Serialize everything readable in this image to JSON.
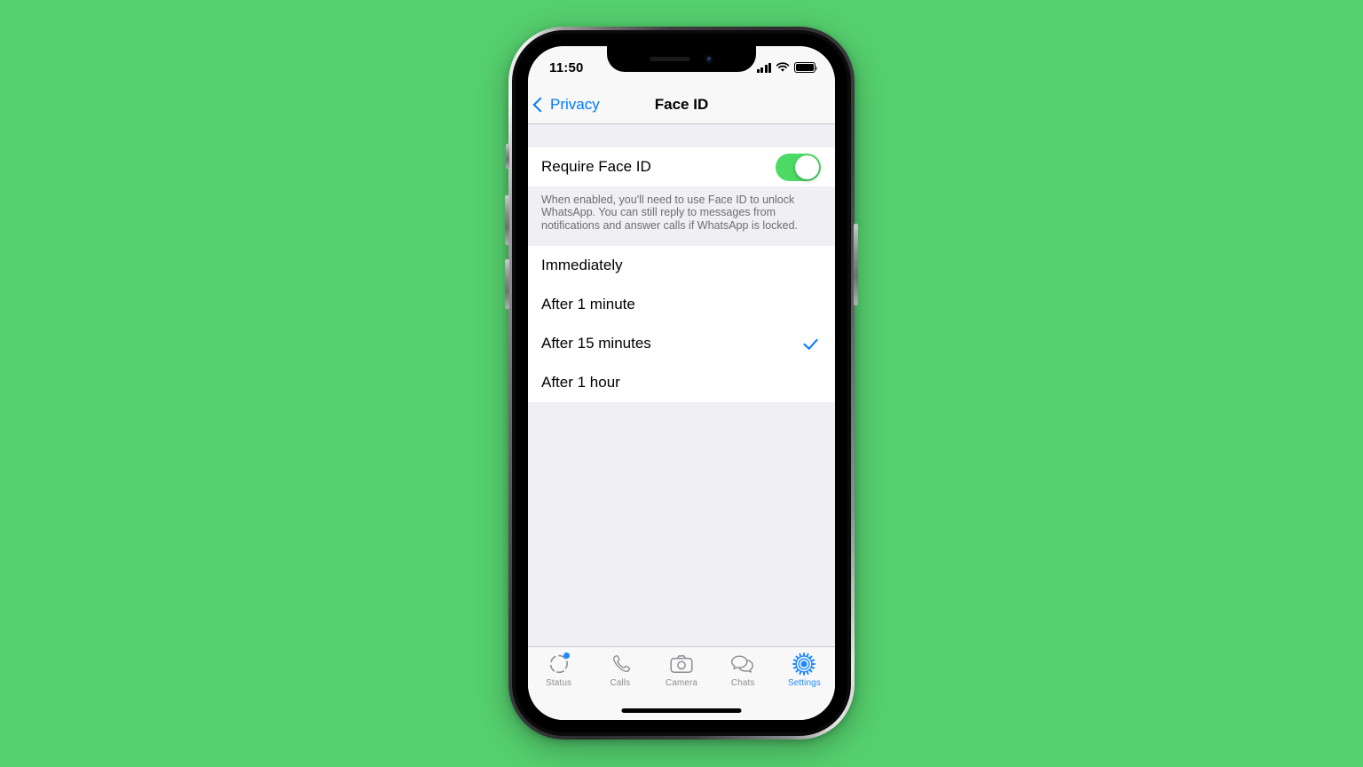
{
  "background_color": "#55d06e",
  "device": {
    "name": "iphone-x-frame",
    "body_color": "#2a2c2e",
    "screen_background": "#efeff4"
  },
  "status_bar": {
    "time": "11:50",
    "signal_icon": "cellular-signal-icon",
    "wifi_icon": "wifi-icon",
    "battery_icon": "battery-icon"
  },
  "nav_bar": {
    "back_icon": "chevron-left-icon",
    "back_label": "Privacy",
    "title": "Face ID",
    "tint_color": "#007aff"
  },
  "toggle_section": {
    "label": "Require Face ID",
    "toggle_name": "require-face-id-toggle",
    "toggle_state": "on",
    "toggle_on_color": "#4cd964",
    "footer": "When enabled, you'll need to use Face ID to unlock WhatsApp. You can still reply to messages from notifications and answer calls if WhatsApp is locked."
  },
  "options_section": {
    "selected": "After 15 minutes",
    "check_color": "#007aff",
    "items": [
      {
        "label": "Immediately",
        "checked": false
      },
      {
        "label": "After 1 minute",
        "checked": false
      },
      {
        "label": "After 15 minutes",
        "checked": true
      },
      {
        "label": "After 1 hour",
        "checked": false
      }
    ]
  },
  "tab_bar": {
    "active": "Settings",
    "active_color": "#1f88ff",
    "inactive_color": "#8e8e93",
    "tabs": [
      {
        "label": "Status",
        "icon": "status-ring-icon",
        "badge": true
      },
      {
        "label": "Calls",
        "icon": "phone-icon",
        "badge": false
      },
      {
        "label": "Camera",
        "icon": "camera-icon",
        "badge": false
      },
      {
        "label": "Chats",
        "icon": "chat-bubbles-icon",
        "badge": false
      },
      {
        "label": "Settings",
        "icon": "gear-icon",
        "badge": false
      }
    ]
  },
  "home_indicator": "home-indicator-bar"
}
